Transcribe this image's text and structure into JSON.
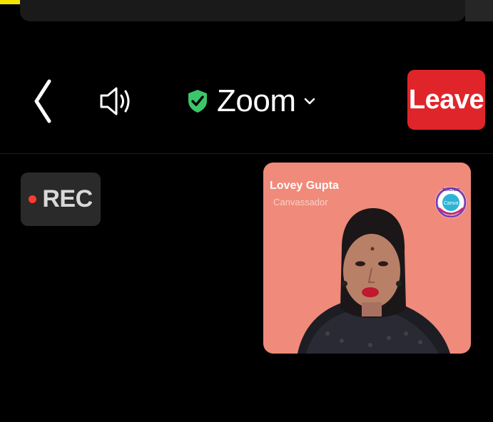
{
  "header": {
    "meeting_title": "Zoom",
    "leave_label": "Leave"
  },
  "icons": {
    "back": "chevron-left-icon",
    "speaker": "speaker-icon",
    "security": "shield-check-icon",
    "dropdown": "chevron-down-icon"
  },
  "recording": {
    "label": "REC"
  },
  "participant": {
    "name": "Lovey Gupta",
    "role": "Canvassador",
    "logo_top_text": "TEACHER",
    "logo_center_text": "Canva",
    "logo_bottom_text": "CANVASSADOR"
  },
  "colors": {
    "leave_button": "#e0252a",
    "security_shield": "#3cc66b",
    "rec_dot": "#ff3b30",
    "tile_background": "#f08a7a",
    "top_strip": "#f5e400"
  }
}
